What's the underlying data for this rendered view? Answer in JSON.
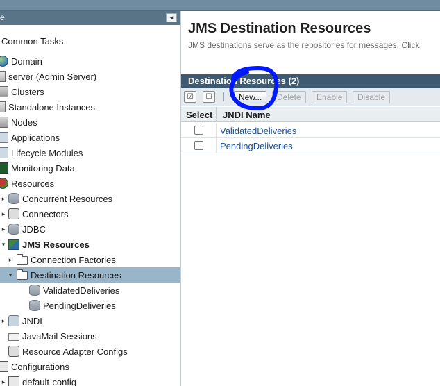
{
  "tree": {
    "header_stub": "e",
    "collapse_glyph": "◂",
    "items": [
      {
        "label": "Common Tasks",
        "bold": false,
        "icon": "none"
      },
      {
        "label": "Domain",
        "icon": "globe-icon"
      },
      {
        "label": "server (Admin Server)",
        "icon": "server-icon"
      },
      {
        "label": "Clusters",
        "icon": "cluster-icon"
      },
      {
        "label": "Standalone Instances",
        "icon": "server-icon"
      },
      {
        "label": "Nodes",
        "icon": "node-icon"
      },
      {
        "label": "Applications",
        "icon": "applications-icon"
      },
      {
        "label": "Lifecycle Modules",
        "icon": "lifecycle-icon"
      },
      {
        "label": "Monitoring Data",
        "icon": "monitoring-icon"
      },
      {
        "label": "Resources",
        "icon": "resources-icon"
      },
      {
        "label": "Concurrent Resources",
        "icon": "database-icon"
      },
      {
        "label": "Connectors",
        "icon": "connector-icon"
      },
      {
        "label": "JDBC",
        "icon": "database-icon"
      },
      {
        "label": "JMS Resources",
        "icon": "jms-icon"
      },
      {
        "label": "Connection Factories",
        "icon": "folder-icon"
      },
      {
        "label": "Destination Resources",
        "icon": "folder-icon"
      },
      {
        "label": "ValidatedDeliveries",
        "icon": "database-icon"
      },
      {
        "label": "PendingDeliveries",
        "icon": "database-icon"
      },
      {
        "label": "JNDI",
        "icon": "jndi-icon"
      },
      {
        "label": "JavaMail Sessions",
        "icon": "mail-icon"
      },
      {
        "label": "Resource Adapter Configs",
        "icon": "connector-icon"
      },
      {
        "label": "Configurations",
        "icon": "configurations-icon"
      },
      {
        "label": "default-config",
        "icon": "config-icon"
      }
    ]
  },
  "main": {
    "title": "JMS Destination Resources",
    "description": "JMS destinations serve as the repositories for messages. Click"
  },
  "table": {
    "title": "Destination Resources (2)",
    "toolbar": {
      "select_all_glyph": "☑",
      "deselect_glyph": "☐",
      "new_label": "New...",
      "delete_label": "Delete",
      "enable_label": "Enable",
      "disable_label": "Disable"
    },
    "columns": [
      "Select",
      "JNDI Name"
    ],
    "rows": [
      {
        "selected": false,
        "jndi_name": "ValidatedDeliveries"
      },
      {
        "selected": false,
        "jndi_name": "PendingDeliveries"
      }
    ]
  },
  "colors": {
    "accent": "#3d5a72",
    "selected_row": "#98b5c9",
    "link": "#1c4f8e",
    "annotation": "#0019ff"
  }
}
